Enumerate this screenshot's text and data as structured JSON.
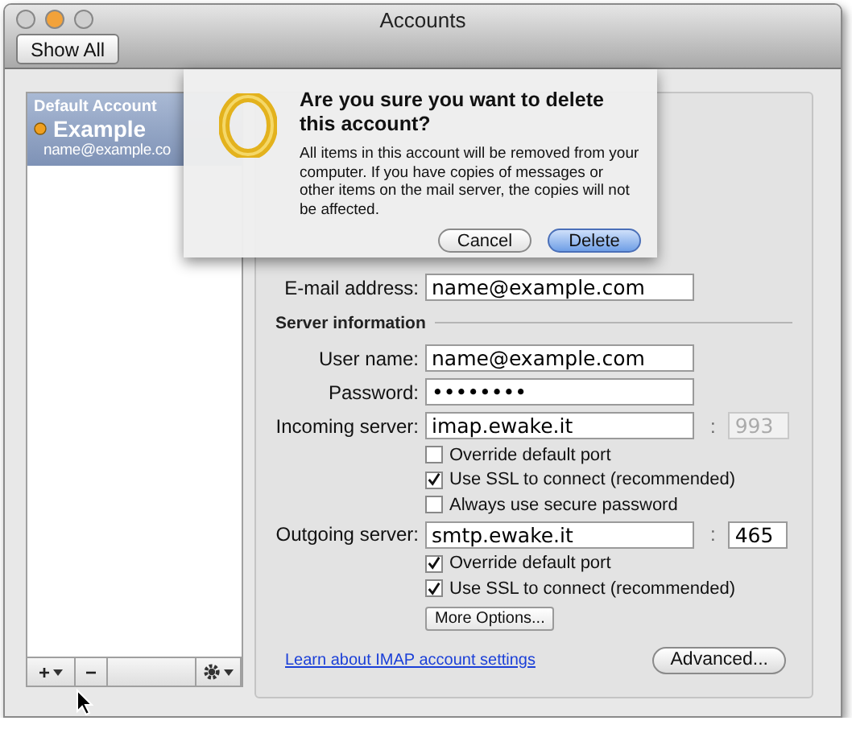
{
  "window": {
    "title": "Accounts"
  },
  "toolbar": {
    "show_all": "Show All"
  },
  "accounts": [
    {
      "header": "Default Account",
      "name": "Example",
      "email": "name@example.co",
      "selected": true
    }
  ],
  "list_buttons": {
    "add": "+",
    "remove": "−"
  },
  "form": {
    "items": [
      {
        "kind": "field",
        "label": "E-mail address:",
        "value": "name@example.com"
      },
      {
        "kind": "section",
        "label": "Server information"
      },
      {
        "kind": "field",
        "label": "User name:",
        "value": "name@example.com"
      },
      {
        "kind": "field",
        "label": "Password:",
        "value": "••••••••"
      },
      {
        "kind": "field",
        "label": "Incoming server:",
        "value": "imap.ewake.it",
        "separator": ":",
        "port": "993",
        "port_disabled": true
      },
      {
        "kind": "checkbox",
        "label": "Override default port",
        "checked": false
      },
      {
        "kind": "checkbox",
        "label": "Use SSL to connect (recommended)",
        "checked": true
      },
      {
        "kind": "checkbox",
        "label": "Always use secure password",
        "checked": false
      },
      {
        "kind": "field",
        "label": "Outgoing server:",
        "value": "smtp.ewake.it",
        "separator": ":",
        "port": "465",
        "port_disabled": false
      },
      {
        "kind": "checkbox",
        "label": "Override default port",
        "checked": true
      },
      {
        "kind": "checkbox",
        "label": "Use SSL to connect (recommended)",
        "checked": true
      },
      {
        "kind": "button",
        "label": "More Options..."
      }
    ],
    "link": "Learn about IMAP account settings",
    "advanced": "Advanced..."
  },
  "dialog": {
    "title": "Are you sure you want to delete this account?",
    "message": "All items in this account will be removed from your computer. If you have copies of messages or other items on the mail server, the copies will not be affected.",
    "buttons": [
      {
        "label": "Cancel",
        "default": false
      },
      {
        "label": "Delete",
        "default": true
      }
    ]
  }
}
